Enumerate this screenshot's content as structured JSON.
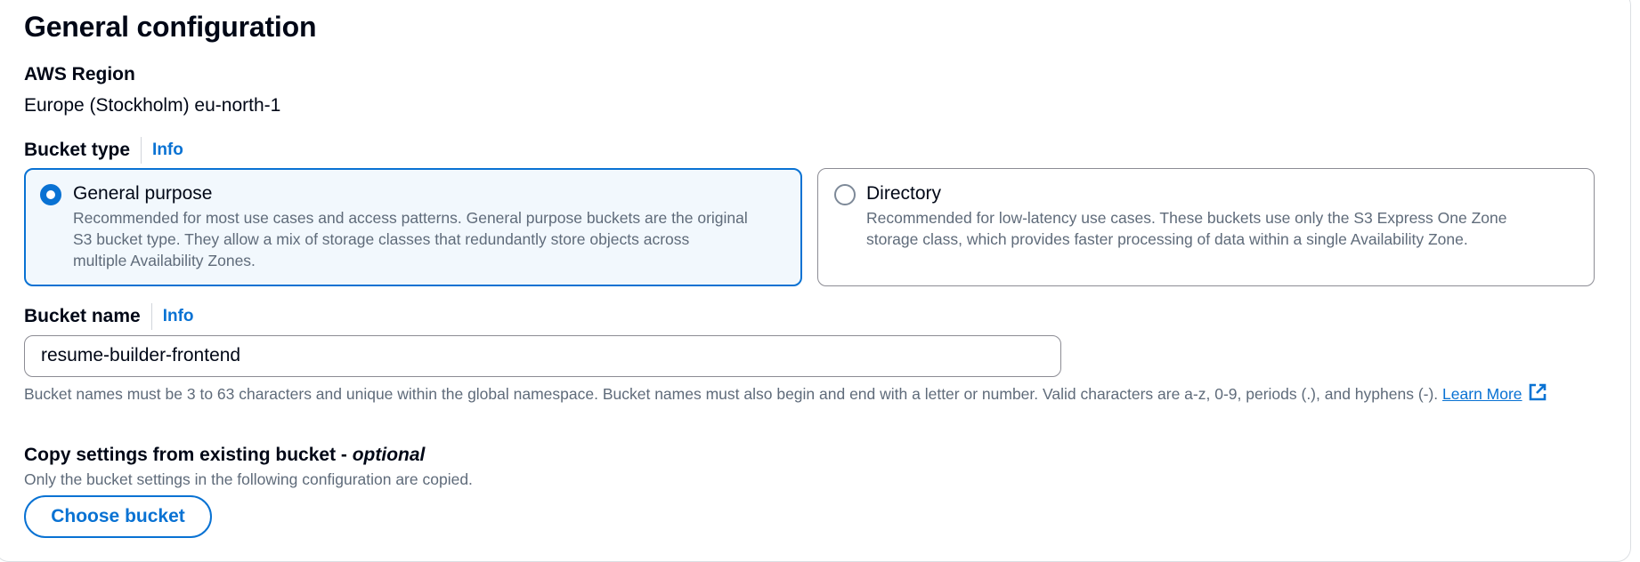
{
  "section": {
    "title": "General configuration"
  },
  "region": {
    "label": "AWS Region",
    "value": "Europe (Stockholm) eu-north-1"
  },
  "bucket_type": {
    "label": "Bucket type",
    "info": "Info",
    "options": [
      {
        "title": "General purpose",
        "description_lines": [
          "Recommended for most use cases and access patterns. General purpose buckets are the original",
          "S3 bucket type. They allow a mix of storage classes that redundantly store objects across",
          "multiple Availability Zones."
        ],
        "selected": true
      },
      {
        "title": "Directory",
        "description_lines": [
          "Recommended for low-latency use cases. These buckets use only the S3 Express One Zone",
          "storage class, which provides faster processing of data within a single Availability Zone."
        ],
        "selected": false
      }
    ]
  },
  "bucket_name": {
    "label": "Bucket name",
    "info": "Info",
    "value": "resume-builder-frontend",
    "constraint_text": "Bucket names must be 3 to 63 characters and unique within the global namespace. Bucket names must also begin and end with a letter or number. Valid characters are a-z, 0-9, periods (.), and hyphens (-).",
    "learn_more": "Learn More"
  },
  "copy_settings": {
    "label": "Copy settings from existing bucket -",
    "optional": "optional",
    "description": "Only the bucket settings in the following configuration are copied.",
    "button_label": "Choose bucket"
  },
  "colors": {
    "accent": "#0972d3",
    "selected_tile_bg": "#f2f8fd",
    "secondary_text": "#5f6b7a",
    "primary_text": "#000716"
  },
  "icons": {
    "external_link": "external-link-icon"
  }
}
